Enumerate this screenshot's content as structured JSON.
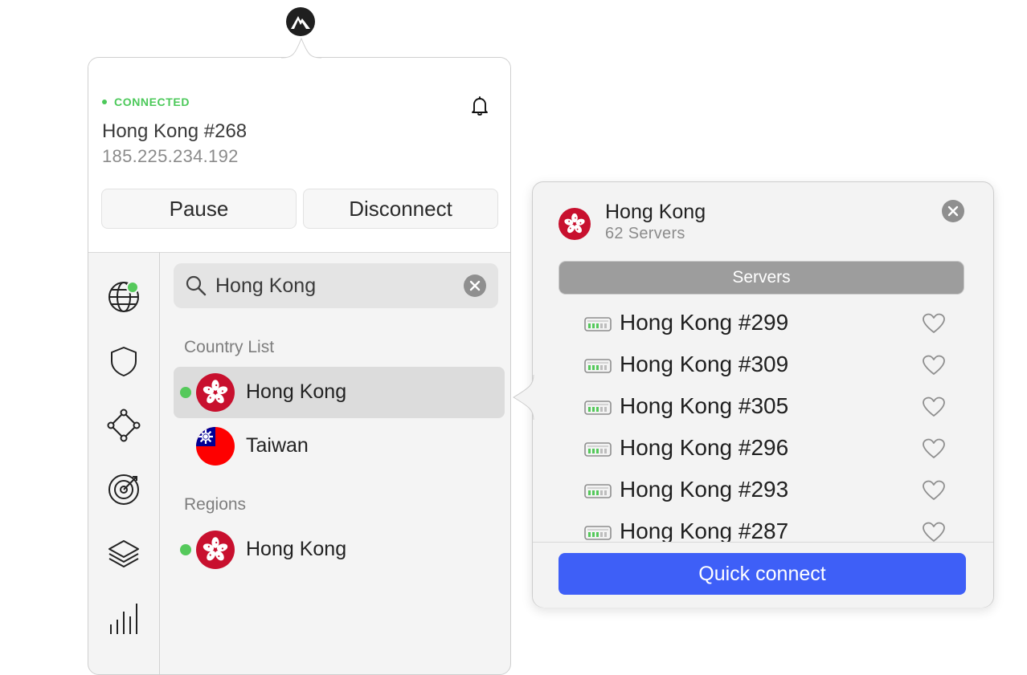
{
  "status": {
    "text": "CONNECTED",
    "color": "#4cc95a"
  },
  "connection": {
    "server_name": "Hong Kong #268",
    "ip": "185.225.234.192"
  },
  "actions": {
    "pause_label": "Pause",
    "disconnect_label": "Disconnect"
  },
  "sidebar": {
    "items": [
      {
        "icon": "globe-icon",
        "active_badge": true
      },
      {
        "icon": "shield-icon"
      },
      {
        "icon": "meshnet-icon"
      },
      {
        "icon": "target-icon"
      },
      {
        "icon": "layers-icon"
      },
      {
        "icon": "stats-icon"
      }
    ]
  },
  "search": {
    "value": "Hong Kong",
    "placeholder": ""
  },
  "country_list": {
    "title": "Country List",
    "items": [
      {
        "label": "Hong Kong",
        "connected": true,
        "selected": true,
        "flag": "hong-kong-flag-icon"
      },
      {
        "label": "Taiwan",
        "connected": false,
        "selected": false,
        "flag": "taiwan-flag-icon"
      }
    ]
  },
  "regions": {
    "title": "Regions",
    "items": [
      {
        "label": "Hong Kong",
        "connected": true,
        "flag": "hong-kong-flag-icon"
      }
    ]
  },
  "servers_panel": {
    "title": "Hong Kong",
    "subtitle": "62 Servers",
    "tab_label": "Servers",
    "servers": [
      {
        "name": "Hong Kong #299"
      },
      {
        "name": "Hong Kong #309"
      },
      {
        "name": "Hong Kong #305"
      },
      {
        "name": "Hong Kong #296"
      },
      {
        "name": "Hong Kong #293"
      },
      {
        "name": "Hong Kong #287"
      }
    ],
    "quick_connect_label": "Quick connect"
  },
  "colors": {
    "accent": "#3e5ff7",
    "connected": "#55c95b",
    "flag_red": "#c8102e"
  }
}
